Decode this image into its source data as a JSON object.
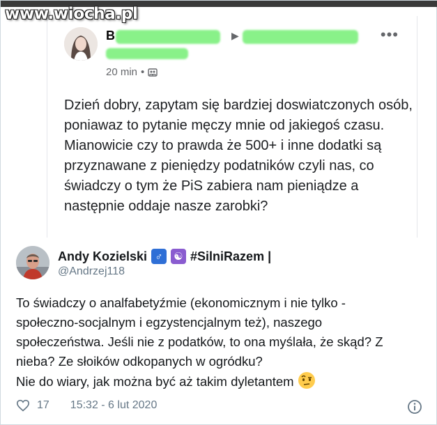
{
  "watermark": "www.wiocha.pl",
  "fb_post": {
    "author_lead": "B",
    "time": "20 min",
    "separator": "•",
    "more": "•••",
    "text": "Dzień dobry, zapytam się bardziej doswiatczonych osób, poniawaz to pytanie męczy mnie od jakiegoś czasu. Mianowicie czy to prawda że 500+ i inne dodatki są przyznawane z pieniędzy podatników czyli nas, co świadczy o tym że PiS zabiera nam pieniądze a następnie oddaje nasze zarobki?"
  },
  "tweet": {
    "name": "Andy Kozielski",
    "badge_1": "♂",
    "badge_2": "☯",
    "hashtag": "#SilniRazem |",
    "handle": "@Andrzej118",
    "text_lines": [
      "To świadczy o analfabetyźmie (ekonomicznym i nie tylko -",
      "społeczno-socjalnym i egzystencjalnym też), naszego",
      "społeczeństwa. Jeśli nie z podatków, to ona myślała, że skąd? Z",
      "nieba? Ze słoików odkopanych w ogródku?",
      "Nie do wiary, jak można być aż takim dyletantem"
    ],
    "likes": "17",
    "timestamp": "15:32 - 6 lut 2020"
  },
  "icons": {
    "heart": "heart-icon",
    "info": "info-icon",
    "globe": "group-privacy-icon",
    "emoji": "raised-eyebrow-emoji"
  },
  "colors": {
    "redaction": "#7ff07f",
    "twitter_text": "#14171a",
    "twitter_muted": "#657786"
  }
}
